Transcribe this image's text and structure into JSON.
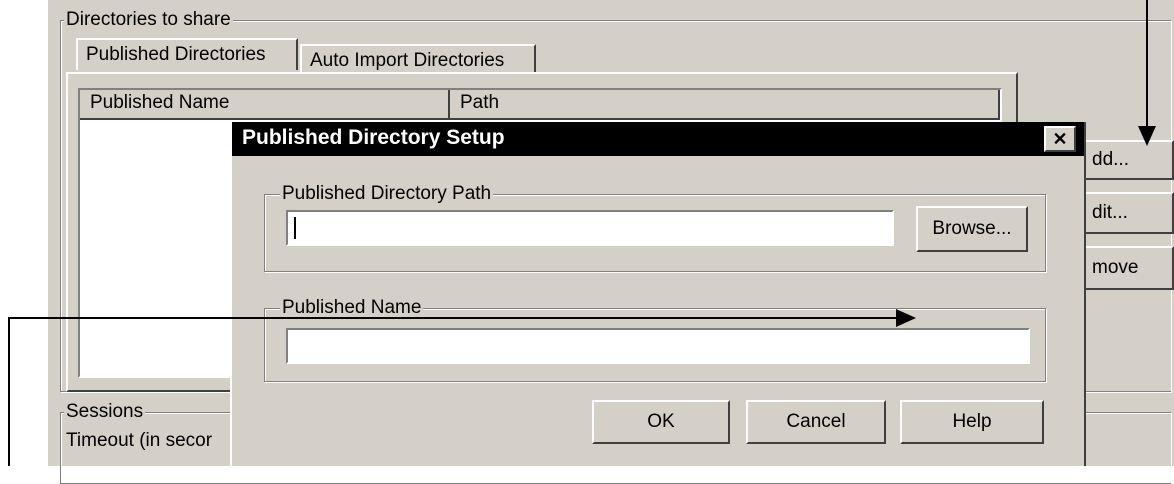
{
  "main": {
    "directories_group_label": "Directories to share",
    "tabs": [
      {
        "label": "Published Directories"
      },
      {
        "label": "Auto Import Directories"
      }
    ],
    "columns": [
      {
        "label": "Published Name"
      },
      {
        "label": "Path"
      }
    ],
    "side_buttons": [
      {
        "label": "dd..."
      },
      {
        "label": "dit..."
      },
      {
        "label": "move"
      }
    ],
    "sessions_group_label": "Sessions",
    "timeout_label": "Timeout (in secor"
  },
  "dialog": {
    "title": "Published Directory Setup",
    "close_glyph": "✕",
    "path_group_label": "Published Directory Path",
    "path_value": "",
    "browse_label": "Browse...",
    "name_group_label": "Published Name",
    "name_value": "",
    "ok_label": "OK",
    "cancel_label": "Cancel",
    "help_label": "Help"
  },
  "icons": {
    "close": "close-icon",
    "callout_arrows": "arrow-icon"
  }
}
